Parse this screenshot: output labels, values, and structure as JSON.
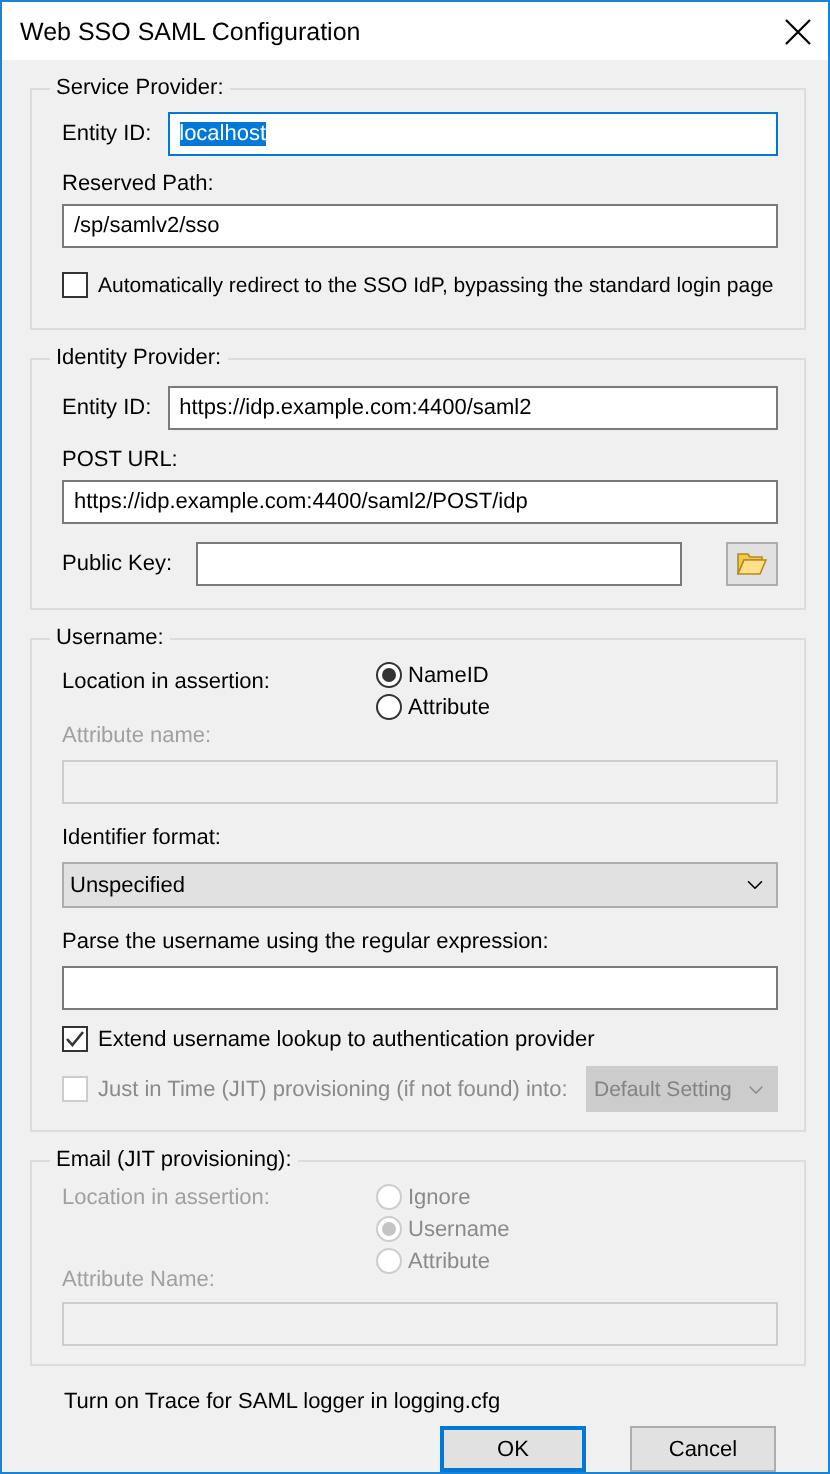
{
  "window": {
    "title": "Web SSO SAML Configuration"
  },
  "service_provider": {
    "legend": "Service Provider:",
    "entity_id": {
      "label": "Entity ID:",
      "value": "localhost",
      "focused": true
    },
    "reserved_path": {
      "label": "Reserved Path:",
      "value": "/sp/samlv2/sso"
    },
    "auto_redirect": {
      "label": "Automatically redirect to the SSO IdP, bypassing the standard login page",
      "checked": false
    }
  },
  "identity_provider": {
    "legend": "Identity Provider:",
    "entity_id": {
      "label": "Entity ID:",
      "value": "https://idp.example.com:4400/saml2"
    },
    "post_url": {
      "label": "POST URL:",
      "value": "https://idp.example.com:4400/saml2/POST/idp"
    },
    "public_key": {
      "label": "Public Key:"
    }
  },
  "username": {
    "legend": "Username:",
    "location_label": "Location in assertion:",
    "location_options": [
      {
        "label": "NameID",
        "selected": true
      },
      {
        "label": "Attribute",
        "selected": false
      }
    ],
    "attribute_name": {
      "label": "Attribute name:",
      "disabled": true
    },
    "identifier_format": {
      "label": "Identifier format:",
      "value": "Unspecified"
    },
    "regex": {
      "label": "Parse the username using the regular expression:"
    },
    "extend_lookup": {
      "label": "Extend username lookup to authentication provider",
      "checked": true,
      "disabled": false
    },
    "jit": {
      "label": "Just in Time (JIT) provisioning (if not found) into:",
      "checked": false,
      "disabled": true,
      "target": "Default Setting"
    }
  },
  "email": {
    "legend": "Email (JIT provisioning):",
    "disabled": true,
    "location_label": "Location in assertion:",
    "location_options": [
      {
        "label": "Ignore",
        "selected": false
      },
      {
        "label": "Username",
        "selected": true
      },
      {
        "label": "Attribute",
        "selected": false
      }
    ],
    "attribute_name": {
      "label": "Attribute Name:",
      "disabled": true
    }
  },
  "trace_note": "Turn on Trace for SAML logger in logging.cfg",
  "buttons": [
    {
      "label": "OK",
      "default": true
    },
    {
      "label": "Cancel",
      "default": false
    }
  ]
}
